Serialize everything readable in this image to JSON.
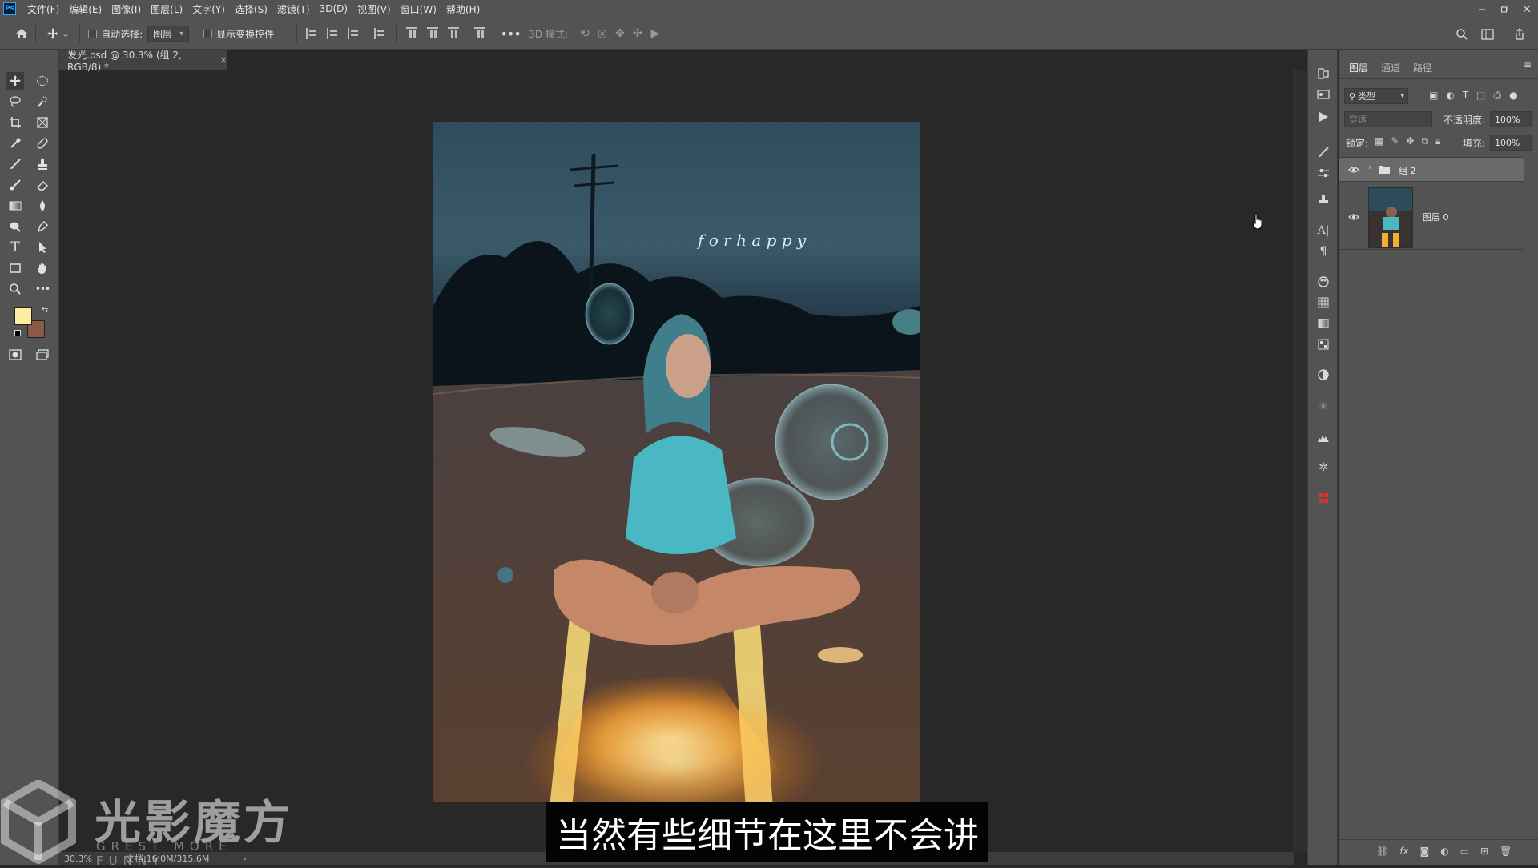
{
  "app": {
    "logo": "Ps"
  },
  "menubar": {
    "items": [
      "文件(F)",
      "编辑(E)",
      "图像(I)",
      "图层(L)",
      "文字(Y)",
      "选择(S)",
      "滤镜(T)",
      "3D(D)",
      "视图(V)",
      "窗口(W)",
      "帮助(H)"
    ],
    "window_controls": [
      "minimize-icon",
      "restore-icon",
      "close-icon"
    ]
  },
  "options_bar": {
    "auto_select_label": "自动选择:",
    "auto_select_value": "图层",
    "show_transform_label": "显示变换控件",
    "mode_3d_label": "3D 模式:"
  },
  "document": {
    "tab_title": "发光.psd @ 30.3% (组 2, RGB/8) *",
    "close_glyph": "×",
    "canvas_text": "f o r   h a p p y"
  },
  "statusbar": {
    "zoom": "30.3%",
    "doc_info": "文档:16.0M/315.6M",
    "arrow": "›"
  },
  "layers_panel": {
    "tabs": [
      "图层",
      "通道",
      "路径"
    ],
    "filter_kind": "类型",
    "blend_mode": "穿透",
    "opacity_label": "不透明度:",
    "opacity_value": "100%",
    "lock_label": "锁定:",
    "fill_label": "填充:",
    "fill_value": "100%",
    "layers": [
      {
        "name": "组 2",
        "type": "group",
        "visible": true,
        "selected": true
      },
      {
        "name": "图层 0",
        "type": "pixel",
        "visible": true,
        "selected": false
      }
    ]
  },
  "colors": {
    "foreground": "#fbeea0",
    "background": "#8a5a48",
    "ui_panel": "#535353",
    "workspace": "#282828"
  },
  "watermark": {
    "title": "光影魔方",
    "subtitle": "GREST MORE FUNNY"
  },
  "subtitle": "当然有些细节在这里不会讲"
}
